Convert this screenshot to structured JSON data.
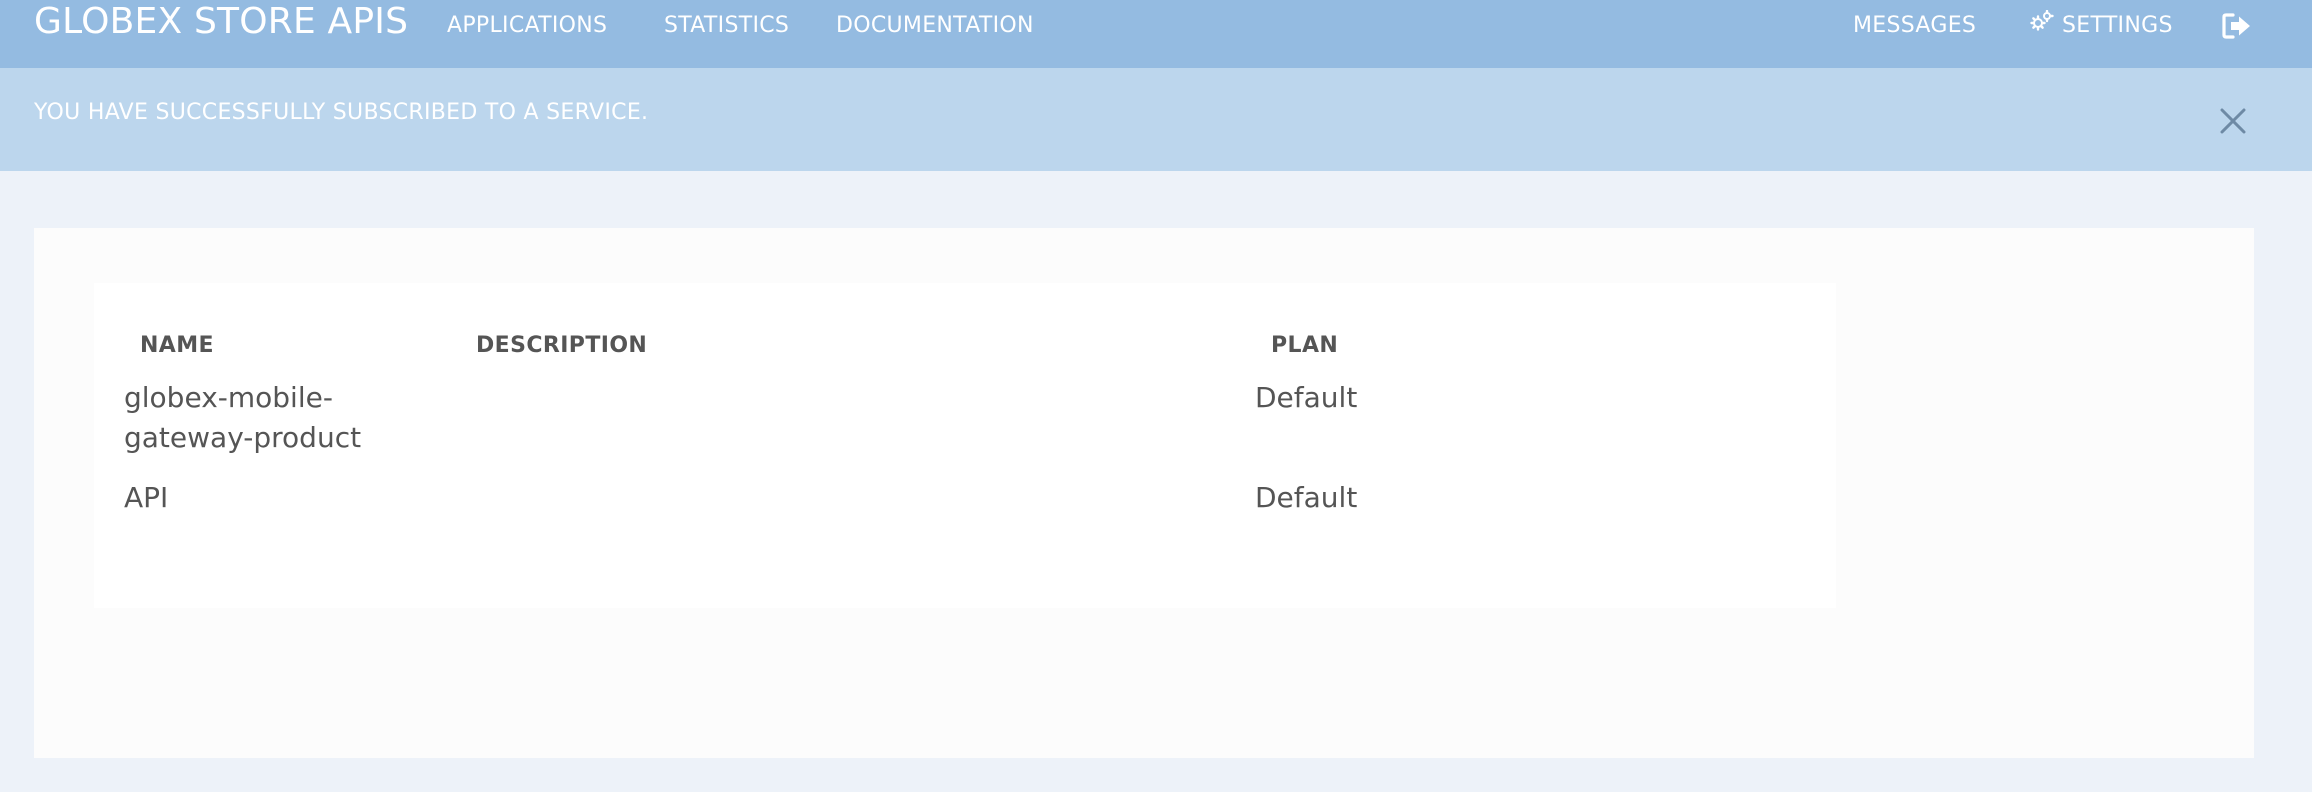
{
  "header": {
    "brand": "GLOBEX STORE APIS",
    "nav": {
      "applications": "APPLICATIONS",
      "statistics": "STATISTICS",
      "documentation": "DOCUMENTATION",
      "messages": "MESSAGES",
      "settings": "SETTINGS"
    },
    "icons": {
      "settings": "gears-icon",
      "logout": "sign-out-icon"
    }
  },
  "alert": {
    "message": "YOU HAVE SUCCESSFULLY SUBSCRIBED TO A SERVICE.",
    "close_icon": "close-icon"
  },
  "table": {
    "columns": [
      "NAME",
      "DESCRIPTION",
      "PLAN"
    ],
    "rows": [
      {
        "name": "globex-mobile-gateway-product",
        "description": "",
        "plan": "Default"
      },
      {
        "name": "API",
        "description": "",
        "plan": "Default"
      }
    ]
  },
  "colors": {
    "header_bg": "#94bbe1",
    "alert_bg": "#bcd6ed",
    "page_bg": "#edf2f9",
    "card_bg": "#fcfcfc",
    "text": "#555555"
  }
}
